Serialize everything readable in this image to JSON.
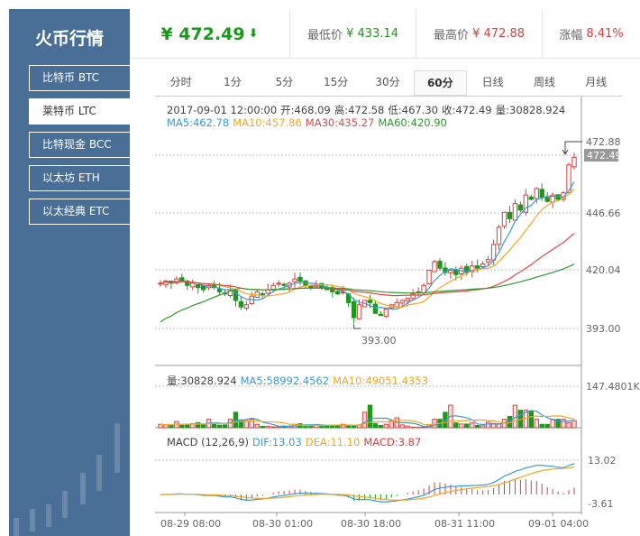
{
  "sidebar": {
    "title": "火币行情",
    "items": [
      {
        "label": "比特币 BTC"
      },
      {
        "label": "莱特币 LTC",
        "active": true
      },
      {
        "label": "比特现金 BCC"
      },
      {
        "label": "以太坊 ETH"
      },
      {
        "label": "以太经典 ETC"
      }
    ]
  },
  "header": {
    "price": "¥ 472.49",
    "low_label": "最低价",
    "low": "¥ 433.14",
    "high_label": "最高价",
    "high": "¥ 472.88",
    "change_label": "涨幅",
    "change": "8.41%"
  },
  "tabs": [
    "分时",
    "1分",
    "5分",
    "15分",
    "30分",
    "60分",
    "日线",
    "周线",
    "月线"
  ],
  "active_tab": "60分",
  "info": {
    "time": "2017-09-01 12:00:00",
    "open": "开:468.09",
    "high": "高:472.58",
    "low": "低:467.30",
    "close": "收:472.49",
    "vol": "量:30828.924",
    "ma5": "MA5:462.78",
    "ma10": "MA10:457.86",
    "ma30": "MA30:435.27",
    "ma60": "MA60:420.90"
  },
  "vol_info": {
    "vol": "量:30828.924",
    "ma5": "MA5:58992.4562",
    "ma10": "MA10:49051.4353"
  },
  "macd_info": {
    "label": "MACD (12,26,9)",
    "dif": "DIF:13.03",
    "dea": "DEA:11.10",
    "macd": "MACD:3.87"
  },
  "colors": {
    "up": "#e23b3b",
    "down": "#1a9a1a",
    "ma5": "#3a9ad9",
    "ma10": "#f5a623",
    "ma30": "#e04848",
    "ma60": "#2e9a2e"
  },
  "chart_data": {
    "type": "candlestick",
    "price_axis": {
      "labels": [
        "472.88",
        "446.66",
        "420.04",
        "393.00"
      ],
      "current": "472.49",
      "min_marker": "393.00",
      "range": [
        388,
        478
      ]
    },
    "vol_axis": {
      "max_label": "147.4801K",
      "max": 147.48
    },
    "macd_axis": {
      "labels": [
        "13.02",
        "-3.61"
      ]
    },
    "x_labels": [
      "08-29 08:00",
      "08-30 01:00",
      "08-30 18:00",
      "08-31 11:00",
      "09-01 04:00"
    ],
    "close": [
      414,
      415,
      414,
      416,
      415,
      413,
      414,
      412,
      411,
      413,
      412,
      410,
      409,
      411,
      406,
      403,
      404,
      408,
      410,
      409,
      411,
      413,
      414,
      413,
      414,
      416,
      415,
      413,
      412,
      413,
      412,
      411,
      410,
      409,
      410,
      405,
      398,
      404,
      406,
      405,
      400,
      399,
      402,
      404,
      405,
      406,
      407,
      409,
      410,
      413,
      420,
      424,
      421,
      419,
      420,
      418,
      421,
      419,
      422,
      421,
      423,
      425,
      432,
      440,
      447,
      444,
      451,
      448,
      455,
      453,
      458,
      454,
      452,
      455,
      453,
      456,
      469,
      472.49
    ],
    "volume": [
      12,
      10,
      9,
      22,
      8,
      12,
      14,
      18,
      11,
      30,
      13,
      9,
      10,
      30,
      55,
      28,
      25,
      30,
      12,
      5,
      5,
      3,
      4,
      6,
      6,
      12,
      14,
      10,
      9,
      10,
      8,
      8,
      9,
      9,
      12,
      6,
      8,
      10,
      55,
      80,
      15,
      8,
      12,
      25,
      35,
      10,
      6,
      2,
      2,
      3,
      10,
      30,
      30,
      55,
      80,
      17,
      13,
      13,
      17,
      8,
      7,
      20,
      15,
      14,
      30,
      40,
      80,
      62,
      62,
      60,
      30,
      12,
      12,
      30,
      30,
      30,
      18,
      25,
      28,
      42,
      52,
      20
    ]
  }
}
